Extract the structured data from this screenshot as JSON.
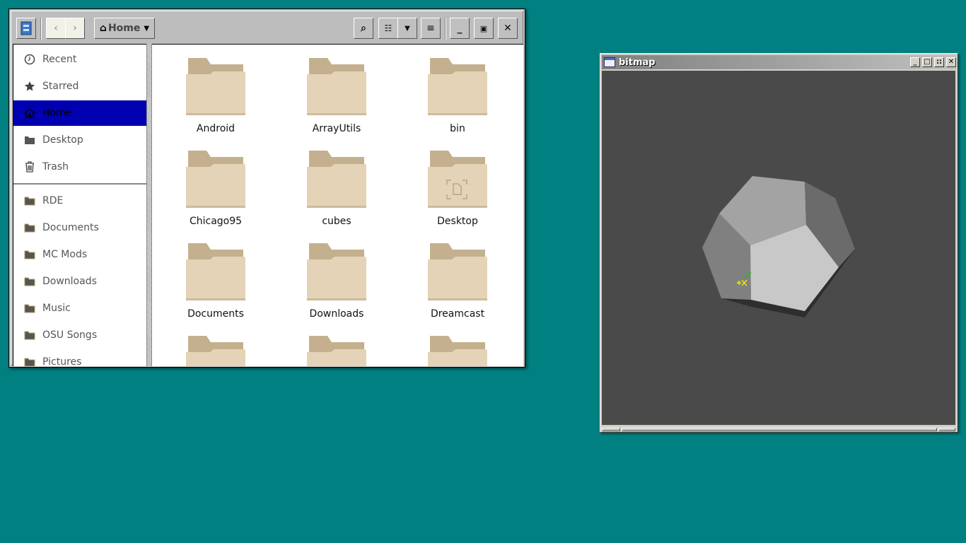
{
  "file_manager": {
    "toolbar": {
      "location": "Home",
      "icons": [
        "file-manager-icon",
        "back-icon",
        "forward-icon",
        "home-icon",
        "search-icon",
        "view-list-icon",
        "chevron-down-icon",
        "menu-icon",
        "minimize-icon",
        "maximize-icon",
        "close-icon"
      ]
    },
    "sidebar": {
      "items": [
        {
          "label": "Recent",
          "icon": "clock-icon"
        },
        {
          "label": "Starred",
          "icon": "star-icon"
        },
        {
          "label": "Home",
          "icon": "home-icon",
          "selected": true
        },
        {
          "label": "Desktop",
          "icon": "folder-icon"
        },
        {
          "label": "Trash",
          "icon": "trash-icon"
        }
      ],
      "bookmarks": [
        "RDE",
        "Documents",
        "MC Mods",
        "Downloads",
        "Music",
        "OSU Songs",
        "Pictures"
      ]
    },
    "selection_color": "#0000b0",
    "folders": [
      "Android",
      "ArrayUtils",
      "bin",
      "Chicago95",
      "cubes",
      "Desktop",
      "Documents",
      "Downloads",
      "Dreamcast",
      "",
      "",
      ""
    ]
  },
  "bitmap_window": {
    "title": "bitmap",
    "canvas_color": "#4a4a4a"
  }
}
